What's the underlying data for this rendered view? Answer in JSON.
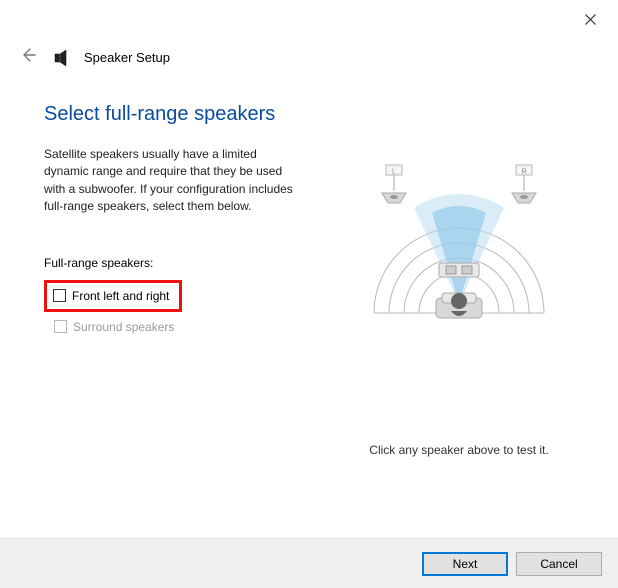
{
  "window": {
    "title": "Speaker Setup"
  },
  "page": {
    "heading": "Select full-range speakers",
    "description": "Satellite speakers usually have a limited dynamic range and require that they be used with a subwoofer.  If your configuration includes full-range speakers, select them below.",
    "subhead": "Full-range speakers:",
    "opt_front": "Front left and right",
    "opt_surround": "Surround speakers",
    "test_hint": "Click any speaker above to test it.",
    "diagram": {
      "left_label": "L",
      "right_label": "R"
    }
  },
  "buttons": {
    "next": "Next",
    "cancel": "Cancel"
  }
}
